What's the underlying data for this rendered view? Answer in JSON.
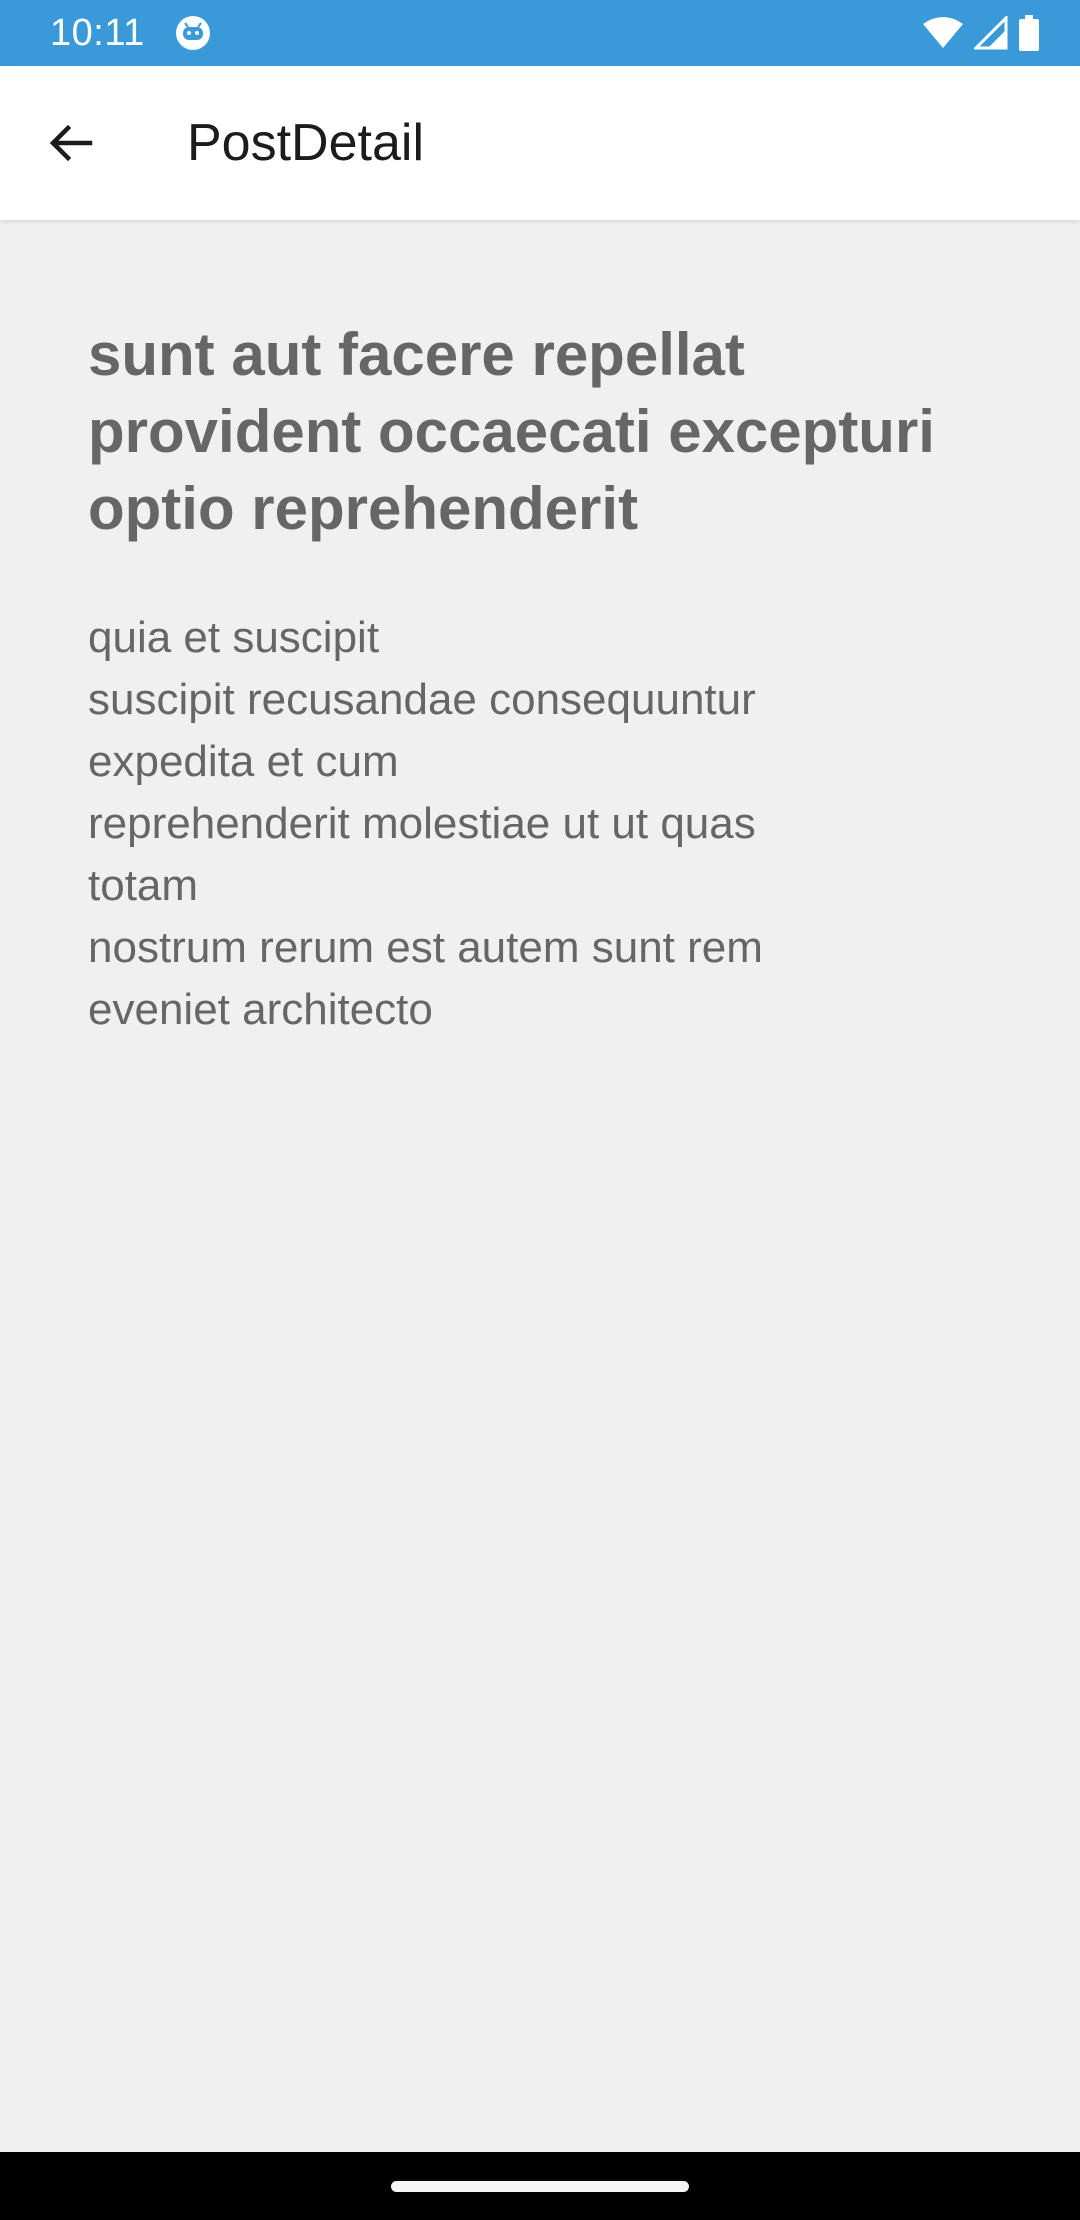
{
  "status_bar": {
    "time": "10:11",
    "app_icon": "android-debug-icon",
    "wifi_icon": "wifi-icon",
    "signal_icon": "signal-icon",
    "battery_icon": "battery-icon",
    "color": "#3a9ad9"
  },
  "app_bar": {
    "back_icon": "arrow-back-icon",
    "title": "PostDetail"
  },
  "post": {
    "title": "sunt aut facere repellat\nprovident occaecati excepturi\noptio reprehenderit",
    "body": "quia et suscipit\nsuscipit recusandae consequuntur\nexpedita et cum\nreprehenderit molestiae ut ut quas\ntotam\nnostrum rerum est autem sunt rem\neveniet architecto"
  }
}
